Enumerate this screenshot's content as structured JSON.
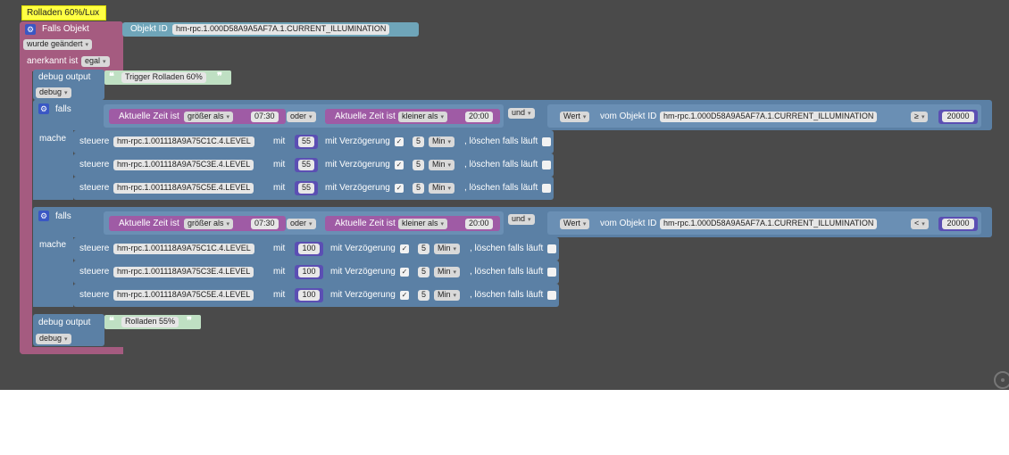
{
  "event": {
    "title": "Rolladen 60%/Lux",
    "label": "Falls Objekt",
    "objekt_id_label": "Objekt ID",
    "objekt_id_value": "hm-rpc.1.000D58A9A5AF7A.1.CURRENT_ILLUMINATION",
    "trigger_option": "wurde geändert",
    "acknowledged_label": "anerkannt ist",
    "acknowledged_option": "egal"
  },
  "debug1": {
    "label": "debug output",
    "text": "Trigger Rolladen 60%",
    "level": "debug"
  },
  "if_blocks": [
    {
      "falls_label": "falls",
      "mache_label": "mache",
      "time_label_1": "Aktuelle Zeit ist",
      "compare_1": "größer als",
      "time_1": "07:30",
      "logic_or": "oder",
      "time_label_2": "Aktuelle Zeit ist",
      "compare_2": "kleiner als",
      "time_2": "20:00",
      "logic_and": "und",
      "value_option": "Wert",
      "from_object_label": "vom Objekt ID",
      "object_id": "hm-rpc.1.000D58A9A5AF7A.1.CURRENT_ILLUMINATION",
      "operator": "≥",
      "threshold": "20000",
      "actions": [
        {
          "steuere": "steuere",
          "device": "hm-rpc.1.001118A9A75C1C.4.LEVEL",
          "mit": "mit",
          "value": "55",
          "delay_label": "mit Verzögerung",
          "checked": "✓",
          "delay": "5",
          "unit": "Min",
          "clear_label": ", löschen falls läuft"
        },
        {
          "steuere": "steuere",
          "device": "hm-rpc.1.001118A9A75C3E.4.LEVEL",
          "mit": "mit",
          "value": "55",
          "delay_label": "mit Verzögerung",
          "checked": "✓",
          "delay": "5",
          "unit": "Min",
          "clear_label": ", löschen falls läuft"
        },
        {
          "steuere": "steuere",
          "device": "hm-rpc.1.001118A9A75C5E.4.LEVEL",
          "mit": "mit",
          "value": "55",
          "delay_label": "mit Verzögerung",
          "checked": "✓",
          "delay": "5",
          "unit": "Min",
          "clear_label": ", löschen falls läuft"
        }
      ]
    },
    {
      "falls_label": "falls",
      "mache_label": "mache",
      "time_label_1": "Aktuelle Zeit ist",
      "compare_1": "größer als",
      "time_1": "07:30",
      "logic_or": "oder",
      "time_label_2": "Aktuelle Zeit ist",
      "compare_2": "kleiner als",
      "time_2": "20:00",
      "logic_and": "und",
      "value_option": "Wert",
      "from_object_label": "vom Objekt ID",
      "object_id": "hm-rpc.1.000D58A9A5AF7A.1.CURRENT_ILLUMINATION",
      "operator": "<",
      "threshold": "20000",
      "actions": [
        {
          "steuere": "steuere",
          "device": "hm-rpc.1.001118A9A75C1C.4.LEVEL",
          "mit": "mit",
          "value": "100",
          "delay_label": "mit Verzögerung",
          "checked": "✓",
          "delay": "5",
          "unit": "Min",
          "clear_label": ", löschen falls läuft"
        },
        {
          "steuere": "steuere",
          "device": "hm-rpc.1.001118A9A75C3E.4.LEVEL",
          "mit": "mit",
          "value": "100",
          "delay_label": "mit Verzögerung",
          "checked": "✓",
          "delay": "5",
          "unit": "Min",
          "clear_label": ", löschen falls läuft"
        },
        {
          "steuere": "steuere",
          "device": "hm-rpc.1.001118A9A75C5E.4.LEVEL",
          "mit": "mit",
          "value": "100",
          "delay_label": "mit Verzögerung",
          "checked": "✓",
          "delay": "5",
          "unit": "Min",
          "clear_label": ", löschen falls läuft"
        }
      ]
    }
  ],
  "debug2": {
    "label": "debug output",
    "text": "Rolladen 55%",
    "level": "debug"
  },
  "icons": {
    "gear": "⚙",
    "quote_open": "❝",
    "quote_close": "❞",
    "dropdown": "▾"
  },
  "colors": {
    "event_block": "#a55b80",
    "logic_block": "#5b80a5",
    "time_block": "#9f5ba5",
    "title_comment": "#ffff44",
    "workspace": "#4a4a4a"
  }
}
